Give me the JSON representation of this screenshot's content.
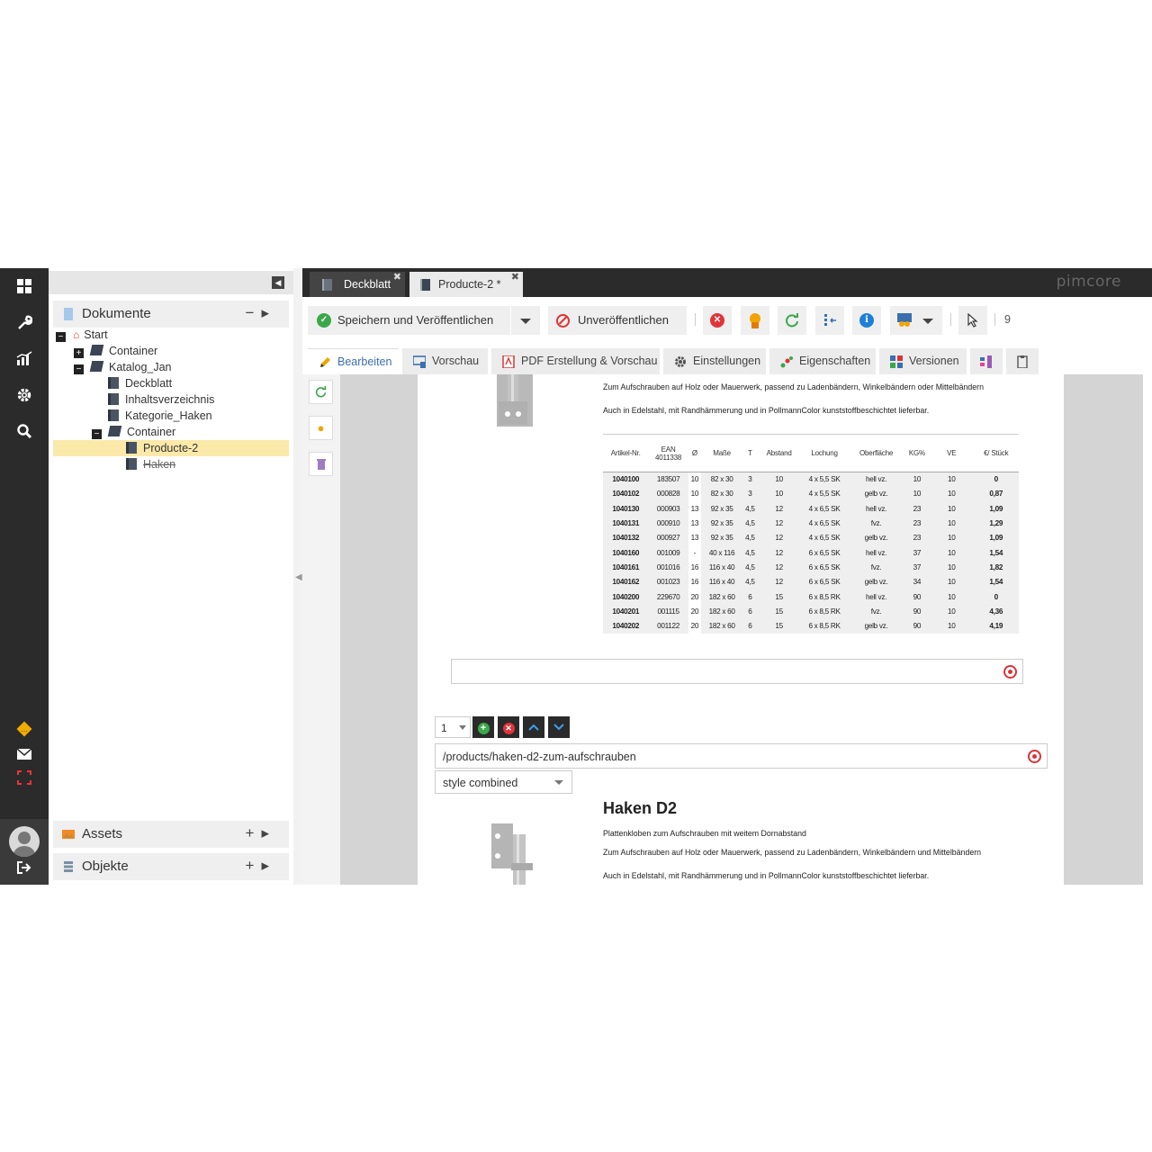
{
  "rail": {
    "icons": [
      "grid-icon",
      "wrench-icon",
      "chart-icon",
      "gear-icon",
      "search-icon",
      "warning-icon",
      "mail-icon",
      "focus-icon",
      "logout-icon"
    ]
  },
  "tree": {
    "header": "Dokumente",
    "nodes": [
      {
        "label": "Start"
      },
      {
        "label": "Container"
      },
      {
        "label": "Katalog_Jan"
      },
      {
        "label": "Deckblatt"
      },
      {
        "label": "Inhaltsverzeichnis"
      },
      {
        "label": "Kategorie_Haken"
      },
      {
        "label": "Container"
      },
      {
        "label": "Producte-2"
      },
      {
        "label": "Haken"
      }
    ],
    "assets": "Assets",
    "objects": "Objekte"
  },
  "tabs": [
    {
      "label": "Deckblatt"
    },
    {
      "label": "Producte-2 *"
    }
  ],
  "brand": "pimcore",
  "toolbar": {
    "publish": "Speichern und Veröffentlichen",
    "unpublish": "Unveröffentlichen",
    "count": "9"
  },
  "subtabs": [
    {
      "label": "Bearbeiten"
    },
    {
      "label": "Vorschau"
    },
    {
      "label": "PDF Erstellung & Vorschau"
    },
    {
      "label": "Einstellungen"
    },
    {
      "label": "Eigenschaften"
    },
    {
      "label": "Versionen"
    }
  ],
  "content": {
    "line1": "Zum Aufschrauben auf Holz oder Mauerwerk, passend zu Ladenbändern, Winkelbändern oder Mittelbändern",
    "line2": "Auch in Edelstahl, mit Randhämmerung und in PollmannColor kunststoffbeschichtet lieferbar.",
    "table_headers": [
      "Artikel-Nr.",
      "EAN 4011338",
      "Ø",
      "Maße",
      "T",
      "Abstand",
      "Lochung",
      "Oberfläche",
      "KG%",
      "VE",
      "€/ Stück"
    ],
    "rows": [
      [
        "1040100",
        "183507",
        "10",
        "82 x 30",
        "3",
        "10",
        "4 x 5,5 SK",
        "hell vz.",
        "10",
        "10",
        "0"
      ],
      [
        "1040102",
        "000828",
        "10",
        "82 x 30",
        "3",
        "10",
        "4 x 5,5 SK",
        "gelb vz.",
        "10",
        "10",
        "0,87"
      ],
      [
        "1040130",
        "000903",
        "13",
        "92 x 35",
        "4,5",
        "12",
        "4 x 6,5 SK",
        "hell vz.",
        "23",
        "10",
        "1,09"
      ],
      [
        "1040131",
        "000910",
        "13",
        "92 x 35",
        "4,5",
        "12",
        "4 x 6,5 SK",
        "fvz.",
        "23",
        "10",
        "1,29"
      ],
      [
        "1040132",
        "000927",
        "13",
        "92 x 35",
        "4,5",
        "12",
        "4 x 6,5 SK",
        "gelb vz.",
        "23",
        "10",
        "1,09"
      ],
      [
        "1040160",
        "001009",
        "-",
        "40 x 116",
        "4,5",
        "12",
        "6 x 6,5 SK",
        "hell vz.",
        "37",
        "10",
        "1,54"
      ],
      [
        "1040161",
        "001016",
        "16",
        "116 x 40",
        "4,5",
        "12",
        "6 x 6,5 SK",
        "fvz.",
        "37",
        "10",
        "1,82"
      ],
      [
        "1040162",
        "001023",
        "16",
        "116 x 40",
        "4,5",
        "12",
        "6 x 6,5 SK",
        "gelb vz.",
        "34",
        "10",
        "1,54"
      ],
      [
        "1040200",
        "229670",
        "20",
        "182 x 60",
        "6",
        "15",
        "6 x 8,5 RK",
        "hell vz.",
        "90",
        "10",
        "0"
      ],
      [
        "1040201",
        "001115",
        "20",
        "182 x 60",
        "6",
        "15",
        "6 x 8,5 RK",
        "fvz.",
        "90",
        "10",
        "4,36"
      ],
      [
        "1040202",
        "001122",
        "20",
        "182 x 60",
        "6",
        "15",
        "6 x 8,5 RK",
        "gelb vz.",
        "90",
        "10",
        "4,19"
      ]
    ],
    "block_index": "1",
    "path": "/products/haken-d2-zum-aufschrauben",
    "style_select": "style combined",
    "title2": "Haken D2",
    "sub2": "Plattenkloben zum Aufschrauben mit weitem Dornabstand",
    "line3": "Zum Aufschrauben auf Holz oder Mauerwerk, passend zu Ladenbändern, Winkelbändern und Mittelbändern",
    "line4": "Auch in Edelstahl, mit Randhämmerung und in PollmannColor kunststoffbeschichtet lieferbar."
  }
}
